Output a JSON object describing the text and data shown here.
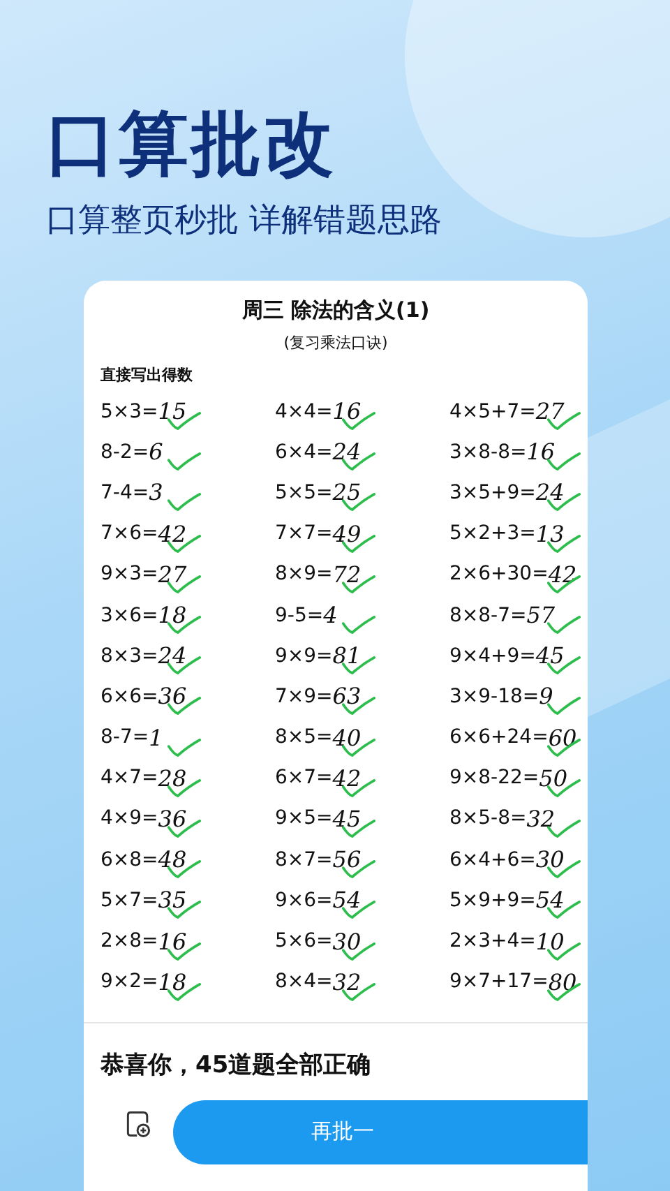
{
  "headline": "口算批改",
  "tagline": "口算整页秒批 详解错题思路",
  "worksheet": {
    "title": "周三  除法的含义(1)",
    "subtitle": "(复习乘法口诀)",
    "instruction": "直接写出得数",
    "problems": [
      {
        "expr": "5×3=",
        "answer": "15",
        "correct": true
      },
      {
        "expr": "4×4=",
        "answer": "16",
        "correct": true
      },
      {
        "expr": "4×5+7=",
        "answer": "27",
        "correct": true
      },
      {
        "expr": "8-2=",
        "answer": "6",
        "correct": true
      },
      {
        "expr": "6×4=",
        "answer": "24",
        "correct": true
      },
      {
        "expr": "3×8-8=",
        "answer": "16",
        "correct": true
      },
      {
        "expr": "7-4=",
        "answer": "3",
        "correct": true
      },
      {
        "expr": "5×5=",
        "answer": "25",
        "correct": true
      },
      {
        "expr": "3×5+9=",
        "answer": "24",
        "correct": true
      },
      {
        "expr": "7×6=",
        "answer": "42",
        "correct": true
      },
      {
        "expr": "7×7=",
        "answer": "49",
        "correct": true
      },
      {
        "expr": "5×2+3=",
        "answer": "13",
        "correct": true
      },
      {
        "expr": "9×3=",
        "answer": "27",
        "correct": true
      },
      {
        "expr": "8×9=",
        "answer": "72",
        "correct": true
      },
      {
        "expr": "2×6+30=",
        "answer": "42",
        "correct": true
      },
      {
        "expr": "3×6=",
        "answer": "18",
        "correct": true
      },
      {
        "expr": "9-5=",
        "answer": "4",
        "correct": true
      },
      {
        "expr": "8×8-7=",
        "answer": "57",
        "correct": true
      },
      {
        "expr": "8×3=",
        "answer": "24",
        "correct": true
      },
      {
        "expr": "9×9=",
        "answer": "81",
        "correct": true
      },
      {
        "expr": "9×4+9=",
        "answer": "45",
        "correct": true
      },
      {
        "expr": "6×6=",
        "answer": "36",
        "correct": true
      },
      {
        "expr": "7×9=",
        "answer": "63",
        "correct": true
      },
      {
        "expr": "3×9-18=",
        "answer": "9",
        "correct": true
      },
      {
        "expr": "8-7=",
        "answer": "1",
        "correct": true
      },
      {
        "expr": "8×5=",
        "answer": "40",
        "correct": true
      },
      {
        "expr": "6×6+24=",
        "answer": "60",
        "correct": true
      },
      {
        "expr": "4×7=",
        "answer": "28",
        "correct": true
      },
      {
        "expr": "6×7=",
        "answer": "42",
        "correct": true
      },
      {
        "expr": "9×8-22=",
        "answer": "50",
        "correct": true
      },
      {
        "expr": "4×9=",
        "answer": "36",
        "correct": true
      },
      {
        "expr": "9×5=",
        "answer": "45",
        "correct": true
      },
      {
        "expr": "8×5-8=",
        "answer": "32",
        "correct": true
      },
      {
        "expr": "6×8=",
        "answer": "48",
        "correct": true
      },
      {
        "expr": "8×7=",
        "answer": "56",
        "correct": true
      },
      {
        "expr": "6×4+6=",
        "answer": "30",
        "correct": true
      },
      {
        "expr": "5×7=",
        "answer": "35",
        "correct": true
      },
      {
        "expr": "9×6=",
        "answer": "54",
        "correct": true
      },
      {
        "expr": "5×9+9=",
        "answer": "54",
        "correct": true
      },
      {
        "expr": "2×8=",
        "answer": "16",
        "correct": true
      },
      {
        "expr": "5×6=",
        "answer": "30",
        "correct": true
      },
      {
        "expr": "2×3+4=",
        "answer": "10",
        "correct": true
      },
      {
        "expr": "9×2=",
        "answer": "18",
        "correct": true
      },
      {
        "expr": "8×4=",
        "answer": "32",
        "correct": true
      },
      {
        "expr": "9×7+17=",
        "answer": "80",
        "correct": true
      }
    ]
  },
  "result": "恭喜你，45道题全部正确",
  "action_button": "再批一"
}
